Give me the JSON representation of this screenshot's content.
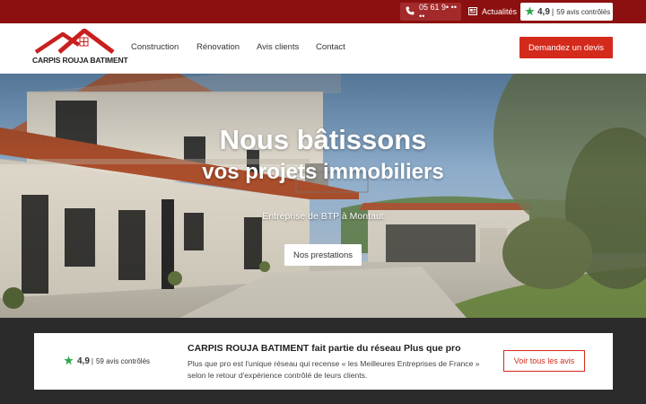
{
  "topbar": {
    "phone": "05 61 9• •• ••",
    "news": "Actualités",
    "rating_score": "4,9",
    "rating_count": "59 avis contrôlés",
    "rating_separator": "|"
  },
  "header": {
    "logo_text": "CARPIS ROUJA BATIMENT",
    "nav": [
      "Construction",
      "Rénovation",
      "Avis clients",
      "Contact"
    ],
    "cta": "Demandez un devis"
  },
  "hero": {
    "title_line1": "Nous bâtissons",
    "title_line2": "vos projets immobiliers",
    "subtitle": "Entreprise de BTP à Montaut",
    "button": "Nos prestations"
  },
  "card": {
    "rating_score": "4,9",
    "rating_count": "59 avis contrôlés",
    "rating_separator": "|",
    "title": "CARPIS ROUJA BATIMENT fait partie du réseau Plus que pro",
    "text": "Plus que pro est l'unique réseau qui recense « les Meilleures Entreprises de France » selon le retour d'expérience contrôlé de leurs clients.",
    "button": "Voir tous les avis"
  },
  "colors": {
    "brand_red": "#d42a1c",
    "topbar_red": "#8c1010",
    "star_green": "#2fa84f"
  },
  "icons": [
    "phone-icon",
    "newspaper-icon",
    "star-icon",
    "logo-roof-icon"
  ]
}
